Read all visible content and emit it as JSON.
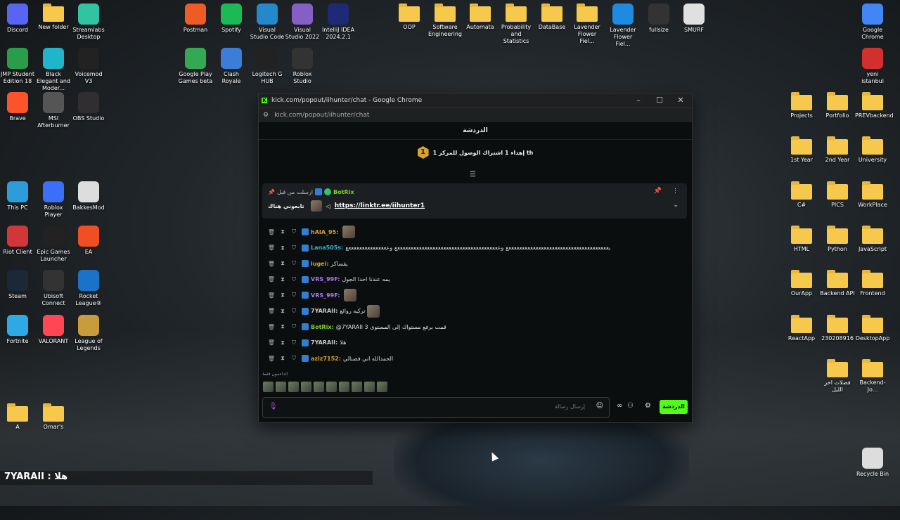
{
  "desktop": {
    "icons": [
      {
        "label": "Discord",
        "icon": "discord-icon",
        "color": "#5865f2"
      },
      {
        "label": "New folder",
        "icon": "folder-icon",
        "color": "#f6c94d"
      },
      {
        "label": "Streamlabs Desktop",
        "icon": "streamlabs-icon",
        "color": "#31c3a2"
      },
      {
        "label": "Postman",
        "icon": "postman-icon",
        "color": "#ef5b25"
      },
      {
        "label": "Spotify",
        "icon": "spotify-icon",
        "color": "#1db954"
      },
      {
        "label": "Visual Studio Code",
        "icon": "vscode-icon",
        "color": "#2489ca"
      },
      {
        "label": "Visual Studio 2022",
        "icon": "vs-icon",
        "color": "#865fc5"
      },
      {
        "label": "IntelliJ IDEA 2024.2.1",
        "icon": "intellij-icon",
        "color": "#1e2a78"
      },
      {
        "label": "OOP",
        "icon": "folder-icon",
        "color": "#f6c94d"
      },
      {
        "label": "Software Engineering",
        "icon": "folder-icon",
        "color": "#f6c94d"
      },
      {
        "label": "Automata",
        "icon": "folder-icon",
        "color": "#f6c94d"
      },
      {
        "label": "Probability and Statistics",
        "icon": "folder-icon",
        "color": "#f6c94d"
      },
      {
        "label": "DataBase",
        "icon": "folder-icon",
        "color": "#f6c94d"
      },
      {
        "label": "Lavender Flower Fiel...",
        "icon": "folder-icon",
        "color": "#f6c94d"
      },
      {
        "label": "Lavender Flower Fiel...",
        "icon": "edge-icon",
        "color": "#1e8ae0"
      },
      {
        "label": "fullsize",
        "icon": "image-icon",
        "color": "#333333"
      },
      {
        "label": "SMURF",
        "icon": "file-icon",
        "color": "#e0e0e0"
      },
      {
        "label": "Google Chrome",
        "icon": "chrome-icon",
        "color": "#4285f4"
      },
      {
        "label": "JMP Student Edition 18",
        "icon": "jmp-icon",
        "color": "#2a9d4a"
      },
      {
        "label": "Black Elegant and Moder...",
        "icon": "canva-icon",
        "color": "#1fb6c9"
      },
      {
        "label": "Voicemod V3",
        "icon": "voicemod-icon",
        "color": "#222222"
      },
      {
        "label": "Google Play Games beta",
        "icon": "playgames-icon",
        "color": "#34a853"
      },
      {
        "label": "Clash Royale",
        "icon": "clash-icon",
        "color": "#3b7dd8"
      },
      {
        "label": "Logitech G HUB",
        "icon": "logitech-icon",
        "color": "#222222"
      },
      {
        "label": "Roblox Studio",
        "icon": "roblox-studio-icon",
        "color": "#333333"
      },
      {
        "label": "yeni istanbul",
        "icon": "pdf-icon",
        "color": "#d32f2f"
      },
      {
        "label": "Brave",
        "icon": "brave-icon",
        "color": "#fb542b"
      },
      {
        "label": "MSI Afterburner",
        "icon": "msi-icon",
        "color": "#555555"
      },
      {
        "label": "OBS Studio",
        "icon": "obs-icon",
        "color": "#302e31"
      },
      {
        "label": "Projects",
        "icon": "folder-icon",
        "color": "#f6c94d"
      },
      {
        "label": "Portfolio",
        "icon": "folder-icon",
        "color": "#f6c94d"
      },
      {
        "label": "PREVbackend",
        "icon": "folder-icon",
        "color": "#f6c94d"
      },
      {
        "label": "1st Year",
        "icon": "folder-icon",
        "color": "#f6c94d"
      },
      {
        "label": "2nd Year",
        "icon": "folder-icon",
        "color": "#f6c94d"
      },
      {
        "label": "University",
        "icon": "folder-icon",
        "color": "#f6c94d"
      },
      {
        "label": "This PC",
        "icon": "monitor-icon",
        "color": "#2d9cdb"
      },
      {
        "label": "Roblox Player",
        "icon": "roblox-icon",
        "color": "#3a6ff7"
      },
      {
        "label": "BakkesMod",
        "icon": "bakkesmod-icon",
        "color": "#dddddd"
      },
      {
        "label": "C#",
        "icon": "folder-icon",
        "color": "#f6c94d"
      },
      {
        "label": "PICS",
        "icon": "folder-icon",
        "color": "#f6c94d"
      },
      {
        "label": "WorkPlace",
        "icon": "folder-icon",
        "color": "#f6c94d"
      },
      {
        "label": "Riot Client",
        "icon": "riot-icon",
        "color": "#d13639"
      },
      {
        "label": "Epic Games Launcher",
        "icon": "epic-icon",
        "color": "#222222"
      },
      {
        "label": "EA",
        "icon": "ea-icon",
        "color": "#f04e23"
      },
      {
        "label": "HTML",
        "icon": "folder-icon",
        "color": "#f6c94d"
      },
      {
        "label": "Python",
        "icon": "folder-icon",
        "color": "#f6c94d"
      },
      {
        "label": "JavaScript",
        "icon": "folder-icon",
        "color": "#f6c94d"
      },
      {
        "label": "Steam",
        "icon": "steam-icon",
        "color": "#1b2838"
      },
      {
        "label": "Ubisoft Connect",
        "icon": "ubisoft-icon",
        "color": "#333333"
      },
      {
        "label": "Rocket League®",
        "icon": "rocketleague-icon",
        "color": "#1a73c9"
      },
      {
        "label": "OurApp",
        "icon": "folder-icon",
        "color": "#f6c94d"
      },
      {
        "label": "Backend API",
        "icon": "folder-icon",
        "color": "#f6c94d"
      },
      {
        "label": "Frontend",
        "icon": "folder-icon",
        "color": "#f6c94d"
      },
      {
        "label": "Fortnite",
        "icon": "fortnite-icon",
        "color": "#2fa8e6"
      },
      {
        "label": "VALORANT",
        "icon": "valorant-icon",
        "color": "#ff4655"
      },
      {
        "label": "League of Legends",
        "icon": "lol-icon",
        "color": "#c89b3c"
      },
      {
        "label": "ReactApp",
        "icon": "folder-icon",
        "color": "#f6c94d"
      },
      {
        "label": "230208916",
        "icon": "folder-icon",
        "color": "#f6c94d"
      },
      {
        "label": "DesktopApp",
        "icon": "folder-icon",
        "color": "#f6c94d"
      },
      {
        "label": "فصلات اخر الليل",
        "icon": "folder-icon",
        "color": "#f6c94d"
      },
      {
        "label": "Backend-Jo...",
        "icon": "folder-icon",
        "color": "#f6c94d"
      },
      {
        "label": "A",
        "icon": "folder-icon",
        "color": "#f6c94d"
      },
      {
        "label": "Omar's",
        "icon": "folder-icon",
        "color": "#f6c94d"
      },
      {
        "label": "Recycle Bin",
        "icon": "recycle-bin-icon",
        "color": "#dddddd"
      }
    ],
    "overlay_text": "7YARAII : هلا"
  },
  "chrome": {
    "title": "kick.com/popout/iihunter/chat - Google Chrome",
    "url": "kick.com/popout/iihunter/chat",
    "minimize": "–",
    "maximize": "☐",
    "close": "✕"
  },
  "chat": {
    "header": "الدردشة",
    "goal_badge": "1",
    "goal_text": "إهداء 1 اشتراك الوصول للمركز 1 th",
    "pinned": {
      "meta": "ارسلت من قبل",
      "author": "BotRix",
      "prefix": "تابعوني هناك",
      "link": "https://linktr.ee/iihunter1"
    },
    "messages": [
      {
        "user": "hAIA_95:",
        "text": "",
        "color": "#d8a42b",
        "emote": true
      },
      {
        "user": "Lana505s:",
        "text": "يعععععععععععععععععععععععععععععععععععععع وععععععععععععععععععععععععععععععععععععععع وعععععععععععععععع",
        "color": "#35b8c9",
        "emote": false
      },
      {
        "user": "lugei:",
        "text": "يقساكر",
        "color": "#d8a42b",
        "emote": false
      },
      {
        "user": "VRS_99F:",
        "text": "يمه عندنا احدا الجول",
        "color": "#a77bf0",
        "emote": false
      },
      {
        "user": "VRS_99F:",
        "text": "",
        "color": "#a77bf0",
        "emote": true
      },
      {
        "user": "7YARAII:",
        "text": "تركيه روائع",
        "color": "#cccccc",
        "emote": true
      },
      {
        "user": "BotRix:",
        "text": "@7YARAII قمت برفع مستواك إلى المستوى 3",
        "color": "#7fd02a",
        "emote": false
      },
      {
        "user": "7YARAII:",
        "text": "هلا",
        "color": "#cccccc",
        "emote": false
      },
      {
        "user": "aziz7152:",
        "text": "الحمدالله اني فضنالي",
        "color": "#d8a42b",
        "emote": false
      }
    ],
    "supporters_label": "الداعمون فقط",
    "input_placeholder": "إرسال رسالة",
    "send_label": "الدردشة"
  }
}
